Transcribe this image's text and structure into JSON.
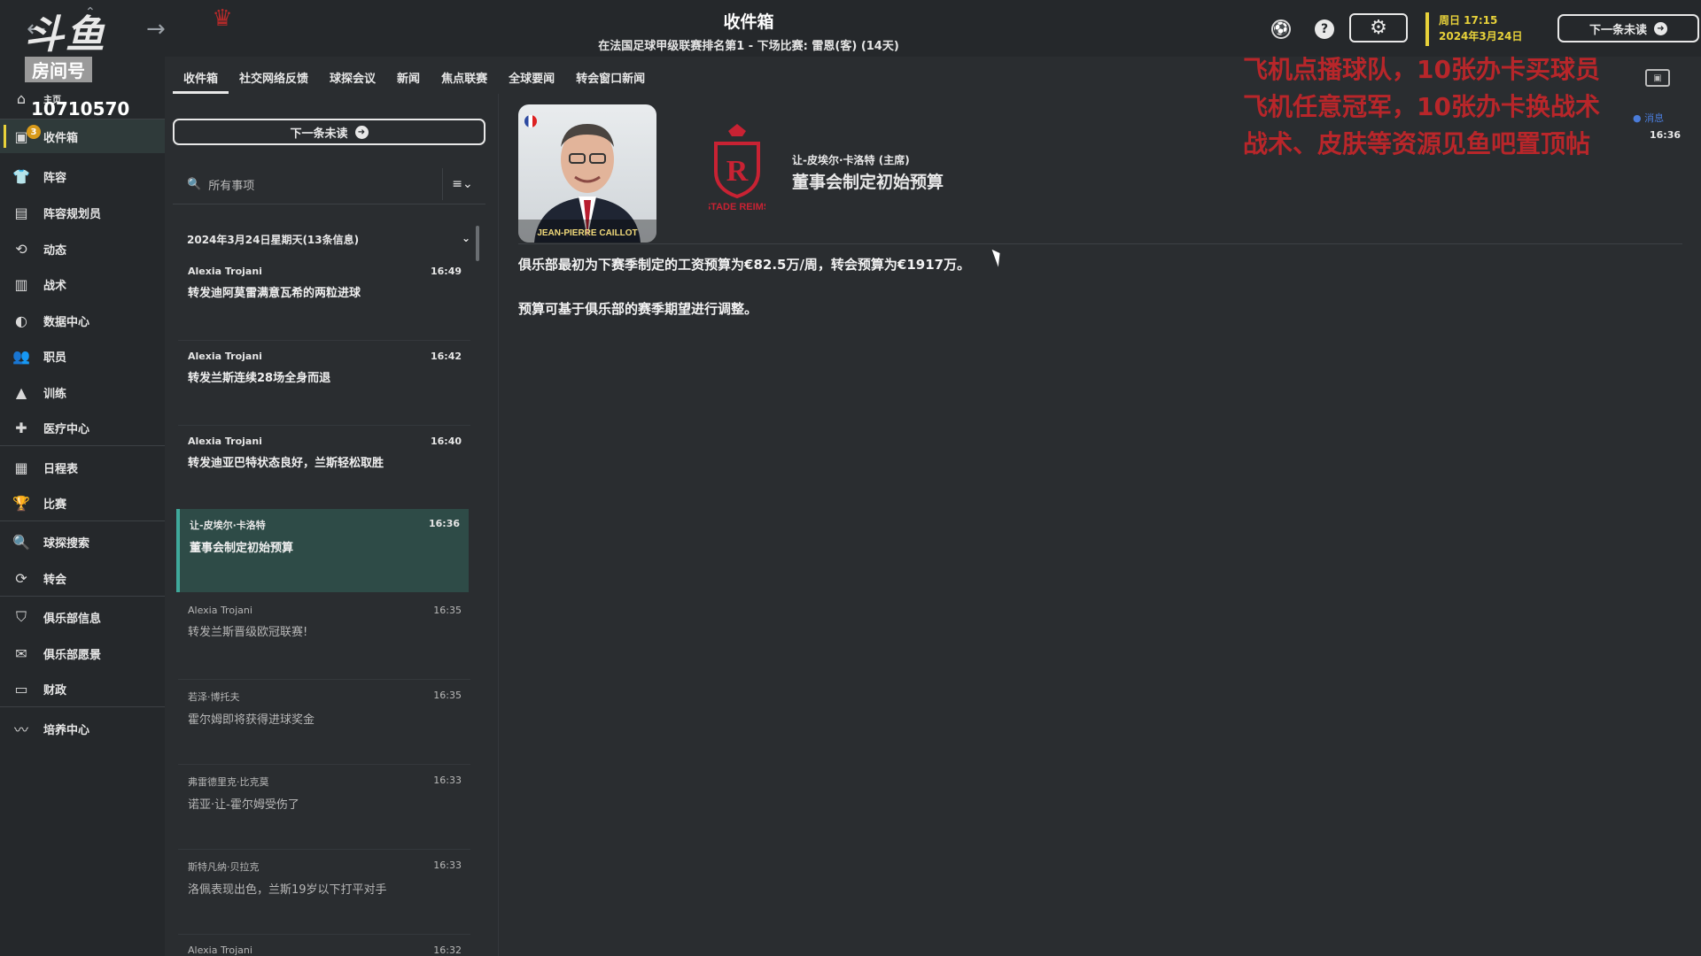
{
  "header": {
    "title": "收件箱",
    "subtitle": "在法国足球甲级联赛排名第1 - 下场比赛: 雷恩(客) (14天)",
    "date_line1": "周日 17:15",
    "date_line2": "2024年3月24日",
    "next_unread_label": "下一条未读"
  },
  "overlay": {
    "logo_text": "斗鱼",
    "room_label": "房间号",
    "room_number": "10710570",
    "promo_lines": [
      "飞机点播球队，10张办卡买球员",
      "飞机任意冠军，10张办卡换战术",
      "战术、皮肤等资源见鱼吧置顶帖"
    ]
  },
  "sidebar": {
    "home_label": "主页",
    "inbox_badge": "3",
    "items": [
      {
        "label": "收件箱",
        "icon": "inbox-icon"
      },
      {
        "label": "阵容",
        "icon": "shirt-icon"
      },
      {
        "label": "阵容规划员",
        "icon": "clipboard-icon"
      },
      {
        "label": "动态",
        "icon": "dynamics-icon"
      },
      {
        "label": "战术",
        "icon": "tactics-icon"
      },
      {
        "label": "数据中心",
        "icon": "data-icon"
      },
      {
        "label": "职员",
        "icon": "staff-icon"
      },
      {
        "label": "训练",
        "icon": "training-icon"
      },
      {
        "label": "医疗中心",
        "icon": "medical-icon"
      },
      {
        "label": "日程表",
        "icon": "calendar-icon"
      },
      {
        "label": "比赛",
        "icon": "trophy-icon"
      },
      {
        "label": "球探搜索",
        "icon": "search-icon"
      },
      {
        "label": "转会",
        "icon": "transfer-icon"
      },
      {
        "label": "俱乐部信息",
        "icon": "shield-icon"
      },
      {
        "label": "俱乐部愿景",
        "icon": "vision-icon"
      },
      {
        "label": "财政",
        "icon": "finance-icon"
      },
      {
        "label": "培养中心",
        "icon": "development-icon"
      }
    ]
  },
  "tabs": [
    "收件箱",
    "社交网络反馈",
    "球探会议",
    "新闻",
    "焦点联赛",
    "全球要闻",
    "转会窗口新闻"
  ],
  "list": {
    "next_unread_label": "下一条未读",
    "search_placeholder": "所有事项",
    "group_header": "2024年3月24日星期天(13条信息)",
    "messages": [
      {
        "sender": "Alexia Trojani",
        "time": "16:49",
        "subject": "转发迪阿莫雷满意瓦希的两粒进球"
      },
      {
        "sender": "Alexia Trojani",
        "time": "16:42",
        "subject": "转发兰斯连续28场全身而退"
      },
      {
        "sender": "Alexia Trojani",
        "time": "16:40",
        "subject": "转发迪亚巴特状态良好，兰斯轻松取胜"
      },
      {
        "sender": "让-皮埃尔·卡洛特",
        "time": "16:36",
        "subject": "董事会制定初始预算"
      },
      {
        "sender": "Alexia Trojani",
        "time": "16:35",
        "subject": "转发兰斯晋级欧冠联赛!"
      },
      {
        "sender": "若泽·博托夫",
        "time": "16:35",
        "subject": "霍尔姆即将获得进球奖金"
      },
      {
        "sender": "弗雷德里克·比克莫",
        "time": "16:33",
        "subject": "诺亚·让-霍尔姆受伤了"
      },
      {
        "sender": "斯特凡纳·贝拉克",
        "time": "16:33",
        "subject": "洛佩表现出色，兰斯19岁以下打平对手"
      },
      {
        "sender": "Alexia Trojani",
        "time": "16:32",
        "subject": ""
      }
    ]
  },
  "detail": {
    "photo_caption": "JEAN-PIERRE CAILLOT",
    "crest_text": "STADE REIMS",
    "sender": "让-皮埃尔·卡洛特 (主席)",
    "subject": "董事会制定初始预算",
    "body": [
      "俱乐部最初为下赛季制定的工资预算为€82.5万/周，转会预算为€1917万。",
      "预算可基于俱乐部的赛季期望进行调整。"
    ],
    "tag": "消息",
    "time": "16:36"
  }
}
